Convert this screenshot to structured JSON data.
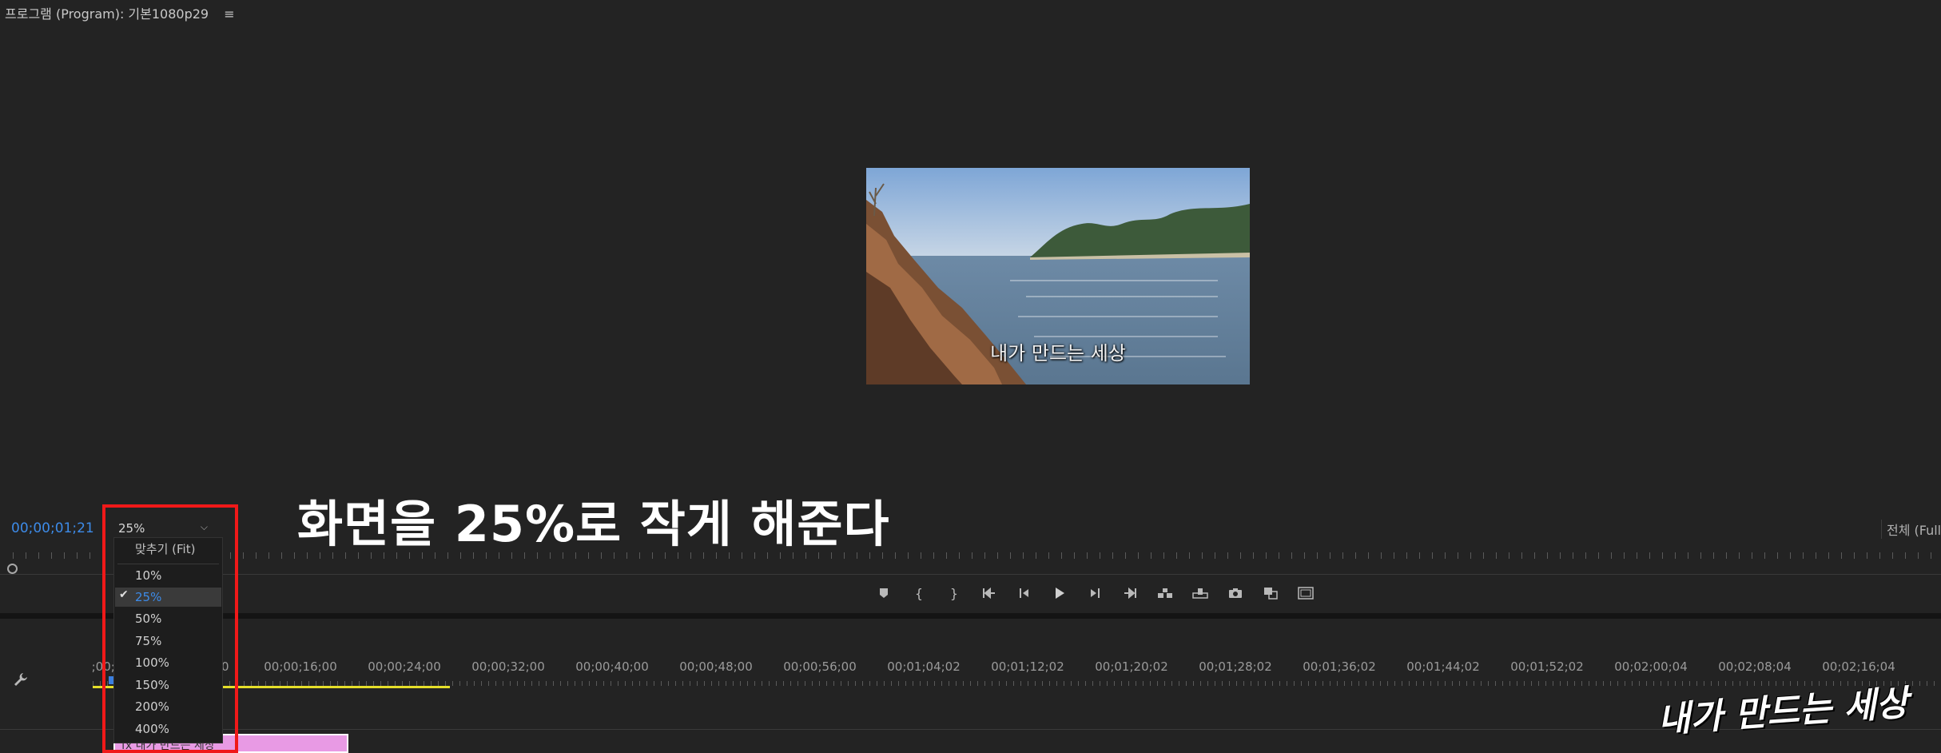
{
  "panel": {
    "title": "프로그램 (Program): 기본1080p29",
    "menu_icon": "≡"
  },
  "video": {
    "caption": "내가 만드는 세상"
  },
  "annotation": "화면을 25%로 작게 해준다",
  "monitor": {
    "timecode": "00;00;01;21",
    "zoom_value": "25%",
    "resolution": "전체 (Full"
  },
  "zoom_menu": {
    "fit": "맞추기 (Fit)",
    "options": [
      "10%",
      "25%",
      "50%",
      "75%",
      "100%",
      "150%",
      "200%",
      "400%"
    ],
    "selected": "25%"
  },
  "transport": {
    "buttons": [
      "marker-icon",
      "mark-in-icon",
      "mark-out-icon",
      "go-to-in-icon",
      "step-back-icon",
      "play-icon",
      "step-forward-icon",
      "go-to-out-icon",
      "insert-icon",
      "overwrite-icon",
      "export-frame-icon",
      "comparison-view-icon",
      "safe-margins-icon"
    ]
  },
  "timeline": {
    "visible_start": ";00;0",
    "partial_label": "00",
    "labels": [
      "00;00;16;00",
      "00;00;24;00",
      "00;00;32;00",
      "00;00;40;00",
      "00;00;48;00",
      "00;00;56;00",
      "00;01;04;02",
      "00;01;12;02",
      "00;01;20;02",
      "00;01;28;02",
      "00;01;36;02",
      "00;01;44;02",
      "00;01;52;02",
      "00;02;00;04",
      "00;02;08;04",
      "00;02;16;04",
      "00"
    ],
    "clip_label": "fx 내가 만드는 세상"
  },
  "watermark": "내가 만드는 세상",
  "colors": {
    "accent_blue": "#3d8be8",
    "annotation_box": "#f01919",
    "clip": "#e89ae4",
    "work_area": "#e5df2a"
  }
}
